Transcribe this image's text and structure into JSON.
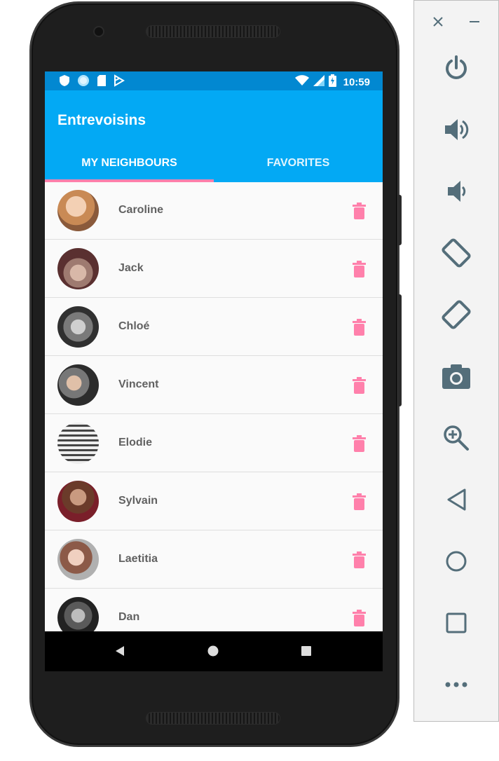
{
  "app": {
    "title": "Entrevoisins",
    "status_time": "10:59",
    "colors": {
      "primary": "#03a9f4",
      "primary_dark": "#0288d1",
      "accent": "#ff80ab"
    }
  },
  "tabs": [
    {
      "label": "MY NEIGHBOURS",
      "selected": true
    },
    {
      "label": "FAVORITES",
      "selected": false
    }
  ],
  "neighbours": [
    {
      "name": "Caroline"
    },
    {
      "name": "Jack"
    },
    {
      "name": "Chloé"
    },
    {
      "name": "Vincent"
    },
    {
      "name": "Elodie"
    },
    {
      "name": "Sylvain"
    },
    {
      "name": "Laetitia"
    },
    {
      "name": "Dan"
    }
  ],
  "status_icons": [
    "shield-icon",
    "circle-sync-icon",
    "sd-card-icon",
    "play-store-icon",
    "wifi-icon",
    "signal-icon",
    "battery-charging-icon"
  ],
  "emulator_panel": {
    "window_controls": [
      "close-icon",
      "minimize-icon"
    ],
    "buttons": [
      "power-icon",
      "volume-up-icon",
      "volume-down-icon",
      "rotate-left-icon",
      "rotate-right-icon",
      "camera-icon",
      "zoom-icon",
      "back-icon",
      "home-icon",
      "overview-icon",
      "more-icon"
    ]
  }
}
